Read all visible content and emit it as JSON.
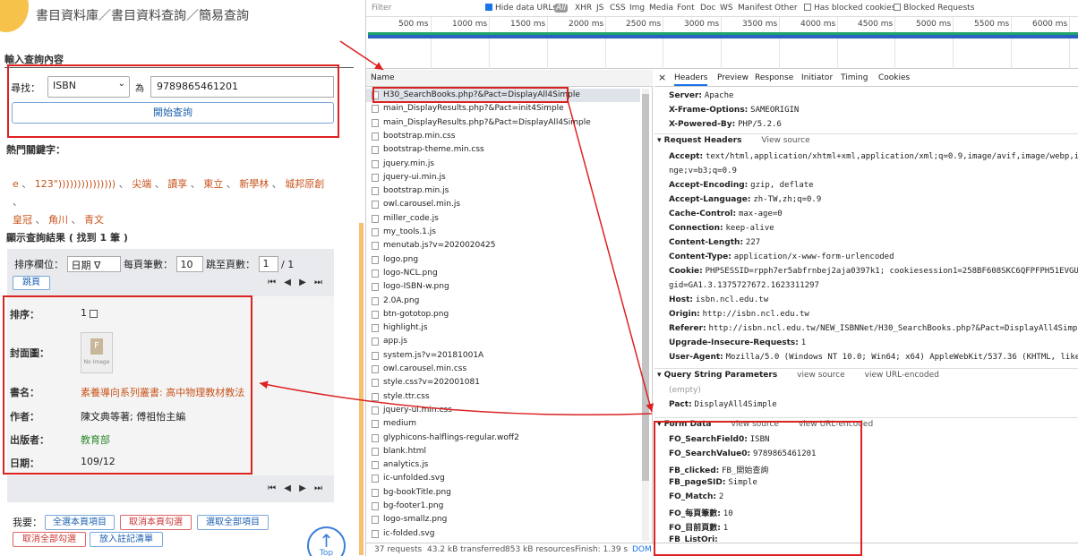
{
  "left": {
    "breadcrumb": "書目資料庫／書目資料查詢／簡易查詢",
    "query_label": "輸入查詢內容",
    "find_label": "尋找：",
    "field_select": "ISBN",
    "wei_label": "為",
    "search_value": "9789865461201",
    "search_button": "開始查詢",
    "hot_keywords_label": "熱門關鍵字：",
    "keywords": [
      "e",
      "123\")))))))))))))))",
      "尖端",
      "讀享",
      "東立",
      "新學林",
      "城邦原創",
      "皇冠",
      "角川",
      "青文"
    ],
    "results_label": "顯示查詢結果 ( 找到 1 筆 )",
    "sort_label": "排序欄位：",
    "sort_value": "日期 ∇",
    "per_page_label": "每頁筆數：",
    "per_page_value": "10",
    "goto_label": "跳至頁數：",
    "page_value": "1",
    "page_total": "/ 1",
    "jump_button": "跳頁",
    "pager": "⏮ ◀ ▶ ⏭",
    "record": {
      "order_label": "排序：",
      "order_value": "1",
      "cover_label": "封面圖：",
      "cover_placeholder": "No Image",
      "title_label": "書名：",
      "title_value": "素養導向系列叢書: 高中物理教材教法",
      "author_label": "作者：",
      "author_value": "陳文典等著; 傅祖怡主編",
      "publisher_label": "出版者：",
      "publisher_value": "教育部",
      "date_label": "日期：",
      "date_value": "109/12"
    },
    "mine_label": "我要：",
    "buttons": [
      "全選本頁項目",
      "取消本頁勾選",
      "選取全部項目",
      "取消全部勾選",
      "放入註記清單"
    ],
    "top_label": "Top"
  },
  "devtools": {
    "filter_placeholder": "Filter",
    "hide_data_urls": "Hide data URLs",
    "all_label": "All",
    "type_filters": [
      "XHR",
      "JS",
      "CSS",
      "Img",
      "Media",
      "Font",
      "Doc",
      "WS",
      "Manifest",
      "Other"
    ],
    "blocked_cookies": "Has blocked cookies",
    "blocked_requests": "Blocked Requests",
    "ticks": [
      "500 ms",
      "1000 ms",
      "1500 ms",
      "2000 ms",
      "2500 ms",
      "3000 ms",
      "3500 ms",
      "4000 ms",
      "4500 ms",
      "5000 ms",
      "5500 ms",
      "6000 ms"
    ],
    "name_header": "Name",
    "requests": [
      "H30_SearchBooks.php?&Pact=DisplayAll4Simple",
      "main_DisplayResults.php?&Pact=init4Simple",
      "main_DisplayResults.php?&Pact=DisplayAll4Simple",
      "bootstrap.min.css",
      "bootstrap-theme.min.css",
      "jquery.min.js",
      "jquery-ui.min.js",
      "bootstrap.min.js",
      "owl.carousel.min.js",
      "miller_code.js",
      "my_tools.1.js",
      "menutab.js?v=2020020425",
      "logo.png",
      "logo-NCL.png",
      "logo-ISBN-w.png",
      "2.0A.png",
      "btn-gototop.png",
      "highlight.js",
      "app.js",
      "system.js?v=20181001A",
      "owl.carousel.min.css",
      "style.css?v=202001081",
      "style.ttr.css",
      "jquery-ui.min.css",
      "medium",
      "glyphicons-halflings-regular.woff2",
      "blank.html",
      "analytics.js",
      "ic-unfolded.svg",
      "bg-bookTitle.png",
      "bg-footer1.png",
      "logo-smallz.png",
      "ic-folded.svg"
    ],
    "status": {
      "requests": "37 requests",
      "transferred": "43.2 kB transferred",
      "resources": "853 kB resources",
      "finish": "Finish: 1.39 s",
      "dom": "DOM"
    },
    "tabs": [
      "Headers",
      "Preview",
      "Response",
      "Initiator",
      "Timing",
      "Cookies"
    ],
    "close_glyph": "×",
    "response_headers": [
      {
        "k": "Server:",
        "v": "Apache"
      },
      {
        "k": "X-Frame-Options:",
        "v": "SAMEORIGIN"
      },
      {
        "k": "X-Powered-By:",
        "v": "PHP/5.2.6"
      }
    ],
    "request_headers_title": "Request Headers",
    "view_source": "View source",
    "view_source_lc": "view source",
    "view_url_encoded": "view URL-encoded",
    "request_headers": [
      {
        "k": "Accept:",
        "v": "text/html,application/xhtml+xml,application/xml;q=0.9,image/avif,image/webp,image/apng,*"
      },
      {
        "k": "",
        "v": "nge;v=b3;q=0.9"
      },
      {
        "k": "Accept-Encoding:",
        "v": "gzip, deflate"
      },
      {
        "k": "Accept-Language:",
        "v": "zh-TW,zh;q=0.9"
      },
      {
        "k": "Cache-Control:",
        "v": "max-age=0"
      },
      {
        "k": "Connection:",
        "v": "keep-alive"
      },
      {
        "k": "Content-Length:",
        "v": "227"
      },
      {
        "k": "Content-Type:",
        "v": "application/x-www-form-urlencoded"
      },
      {
        "k": "Cookie:",
        "v": "PHPSESSID=rpph7er5abfrnbej2aja0397k1; cookiesession1=258BF608SKC6QFPFPH51EVGU1LFH5A38; _"
      },
      {
        "k": "",
        "v": "gid=GA1.3.1375727672.1623311297"
      },
      {
        "k": "Host:",
        "v": "isbn.ncl.edu.tw"
      },
      {
        "k": "Origin:",
        "v": "http://isbn.ncl.edu.tw"
      },
      {
        "k": "Referer:",
        "v": "http://isbn.ncl.edu.tw/NEW_ISBNNet/H30_SearchBooks.php?&Pact=DisplayAll4Simple"
      },
      {
        "k": "Upgrade-Insecure-Requests:",
        "v": "1"
      },
      {
        "k": "User-Agent:",
        "v": "Mozilla/5.0 (Windows NT 10.0; Win64; x64) AppleWebKit/537.36 (KHTML, like Gecko) Chr"
      }
    ],
    "query_params_title": "Query String Parameters",
    "empty_note": "(empty)",
    "query_params": [
      {
        "k": "Pact:",
        "v": "DisplayAll4Simple"
      }
    ],
    "form_data_title": "Form Data",
    "form_data": [
      {
        "k": "FO_SearchField0:",
        "v": "ISBN"
      },
      {
        "k": "FO_SearchValue0:",
        "v": "9789865461201"
      },
      {
        "k": "FB_clicked:",
        "v": "FB_開始查詢"
      },
      {
        "k": "FB_pageSID:",
        "v": "Simple"
      },
      {
        "k": "FO_Match:",
        "v": "2"
      },
      {
        "k": "FO_每頁筆數:",
        "v": "10"
      },
      {
        "k": "FO_目前頁數:",
        "v": "1"
      },
      {
        "k": "FB_ListOri:",
        "v": ""
      }
    ]
  },
  "colors": {
    "highlight": "#dd2222",
    "keyword": "#c8541b",
    "title_value": "#c8541b",
    "publisher_value": "#2e8b2e",
    "link_blue": "#1b5fb0"
  }
}
